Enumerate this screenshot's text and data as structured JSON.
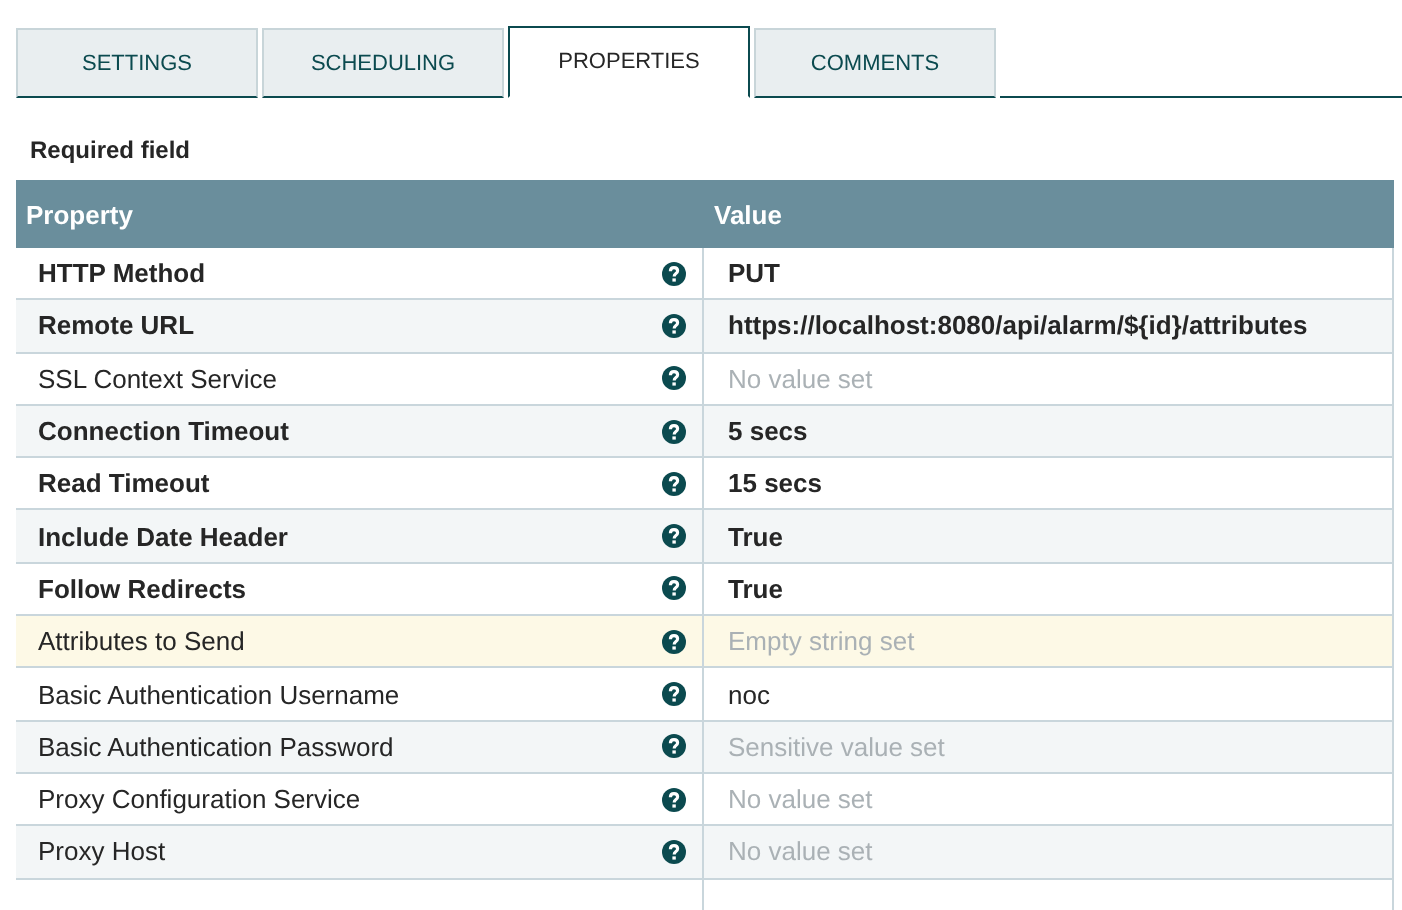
{
  "tabs": [
    {
      "label": "SETTINGS",
      "selected": false
    },
    {
      "label": "SCHEDULING",
      "selected": false
    },
    {
      "label": "PROPERTIES",
      "selected": true
    },
    {
      "label": "COMMENTS",
      "selected": false
    }
  ],
  "required_note": "Required field",
  "table": {
    "columns": [
      "Property",
      "Value"
    ],
    "rows": [
      {
        "property": "HTTP Method",
        "required": true,
        "selected": false,
        "value": "PUT",
        "kind": "set"
      },
      {
        "property": "Remote URL",
        "required": true,
        "selected": false,
        "value": "https://localhost:8080/api/alarm/${id}/attributes",
        "kind": "set"
      },
      {
        "property": "SSL Context Service",
        "required": false,
        "selected": false,
        "value": "No value set",
        "kind": "placeholder"
      },
      {
        "property": "Connection Timeout",
        "required": true,
        "selected": false,
        "value": "5 secs",
        "kind": "set"
      },
      {
        "property": "Read Timeout",
        "required": true,
        "selected": false,
        "value": "15 secs",
        "kind": "set"
      },
      {
        "property": "Include Date Header",
        "required": true,
        "selected": false,
        "value": "True",
        "kind": "set"
      },
      {
        "property": "Follow Redirects",
        "required": true,
        "selected": false,
        "value": "True",
        "kind": "set"
      },
      {
        "property": "Attributes to Send",
        "required": false,
        "selected": true,
        "value": "Empty string set",
        "kind": "placeholder"
      },
      {
        "property": "Basic Authentication Username",
        "required": false,
        "selected": false,
        "value": "noc",
        "kind": "set"
      },
      {
        "property": "Basic Authentication Password",
        "required": false,
        "selected": false,
        "value": "Sensitive value set",
        "kind": "placeholder"
      },
      {
        "property": "Proxy Configuration Service",
        "required": false,
        "selected": false,
        "value": "No value set",
        "kind": "placeholder"
      },
      {
        "property": "Proxy Host",
        "required": false,
        "selected": false,
        "value": "No value set",
        "kind": "placeholder"
      }
    ]
  }
}
